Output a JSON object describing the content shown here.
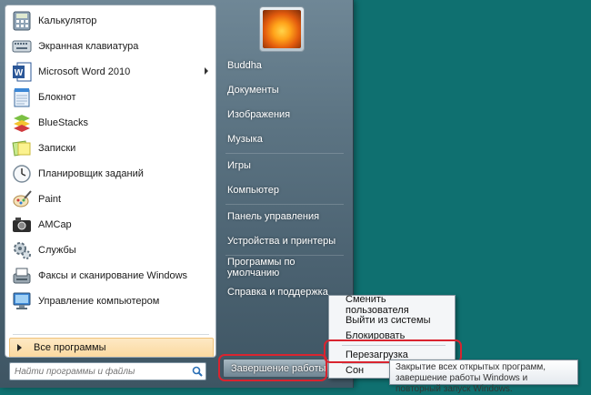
{
  "programs": [
    {
      "label": "Калькулятор",
      "icon": "calculator-icon",
      "has_submenu": false
    },
    {
      "label": "Экранная клавиатура",
      "icon": "keyboard-icon",
      "has_submenu": false
    },
    {
      "label": "Microsoft Word 2010",
      "icon": "word-icon",
      "has_submenu": true
    },
    {
      "label": "Блокнот",
      "icon": "notepad-icon",
      "has_submenu": false
    },
    {
      "label": "BlueStacks",
      "icon": "bluestacks-icon",
      "has_submenu": false
    },
    {
      "label": "Записки",
      "icon": "sticky-notes-icon",
      "has_submenu": false
    },
    {
      "label": "Планировщик заданий",
      "icon": "task-scheduler-icon",
      "has_submenu": false
    },
    {
      "label": "Paint",
      "icon": "paint-icon",
      "has_submenu": false
    },
    {
      "label": "AMCap",
      "icon": "amcap-icon",
      "has_submenu": false
    },
    {
      "label": "Службы",
      "icon": "services-icon",
      "has_submenu": false
    },
    {
      "label": "Факсы и сканирование Windows",
      "icon": "fax-scan-icon",
      "has_submenu": false
    },
    {
      "label": "Управление компьютером",
      "icon": "computer-management-icon",
      "has_submenu": false
    }
  ],
  "all_programs_label": "Все программы",
  "search": {
    "placeholder": "Найти программы и файлы",
    "value": ""
  },
  "right_items": [
    "Buddha",
    "Документы",
    "Изображения",
    "Музыка",
    "Игры",
    "Компьютер",
    "Панель управления",
    "Устройства и принтеры",
    "Программы по умолчанию",
    "Справка и поддержка"
  ],
  "shutdown_label": "Завершение работы",
  "submenu": [
    "Сменить пользователя",
    "Выйти из системы",
    "Блокировать",
    "Перезагрузка",
    "Сон"
  ],
  "tooltip": "Закрытие всех открытых программ, завершение работы Windows и повторный запуск Windows.",
  "colors": {
    "desktop": "#0f7070",
    "highlight_ring": "#d9242f",
    "all_programs_bg": "#fcd9a0"
  }
}
